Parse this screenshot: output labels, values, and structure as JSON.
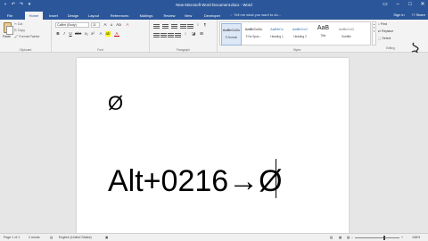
{
  "window": {
    "title": "New Microsoft Word Document.docx - Word",
    "sign_in": "Sign in",
    "share": "Share"
  },
  "tabs": [
    "File",
    "Home",
    "Insert",
    "Design",
    "Layout",
    "References",
    "Mailings",
    "Review",
    "View",
    "Developer"
  ],
  "tell_me": "Tell me what you want to do...",
  "clipboard": {
    "paste": "Paste",
    "cut": "Cut",
    "copy": "Copy",
    "format_painter": "Format Painter",
    "label": "Clipboard"
  },
  "font": {
    "family": "Calibri (Body)",
    "size": "11",
    "label": "Font"
  },
  "paragraph": {
    "label": "Paragraph"
  },
  "styles": {
    "label": "Styles",
    "items": [
      {
        "preview": "AaBbCcDc",
        "name": "¶ Normal"
      },
      {
        "preview": "AaBbCcDc",
        "name": "¶ No Spac..."
      },
      {
        "preview": "AaBbCc",
        "name": "Heading 1"
      },
      {
        "preview": "AaBbCcC",
        "name": "Heading 2"
      },
      {
        "preview": "AaB",
        "name": "Title"
      },
      {
        "preview": "AaBbCcD",
        "name": "Subtitle"
      }
    ]
  },
  "editing": {
    "find": "Find",
    "replace": "Replace",
    "select": "Select",
    "label": "Editing"
  },
  "document": {
    "line1": "Ø",
    "line2": "Alt+0216→Ø"
  },
  "status": {
    "page": "Page 1 of 1",
    "words": "2 words",
    "language": "English (United States)",
    "zoom": "158%"
  }
}
